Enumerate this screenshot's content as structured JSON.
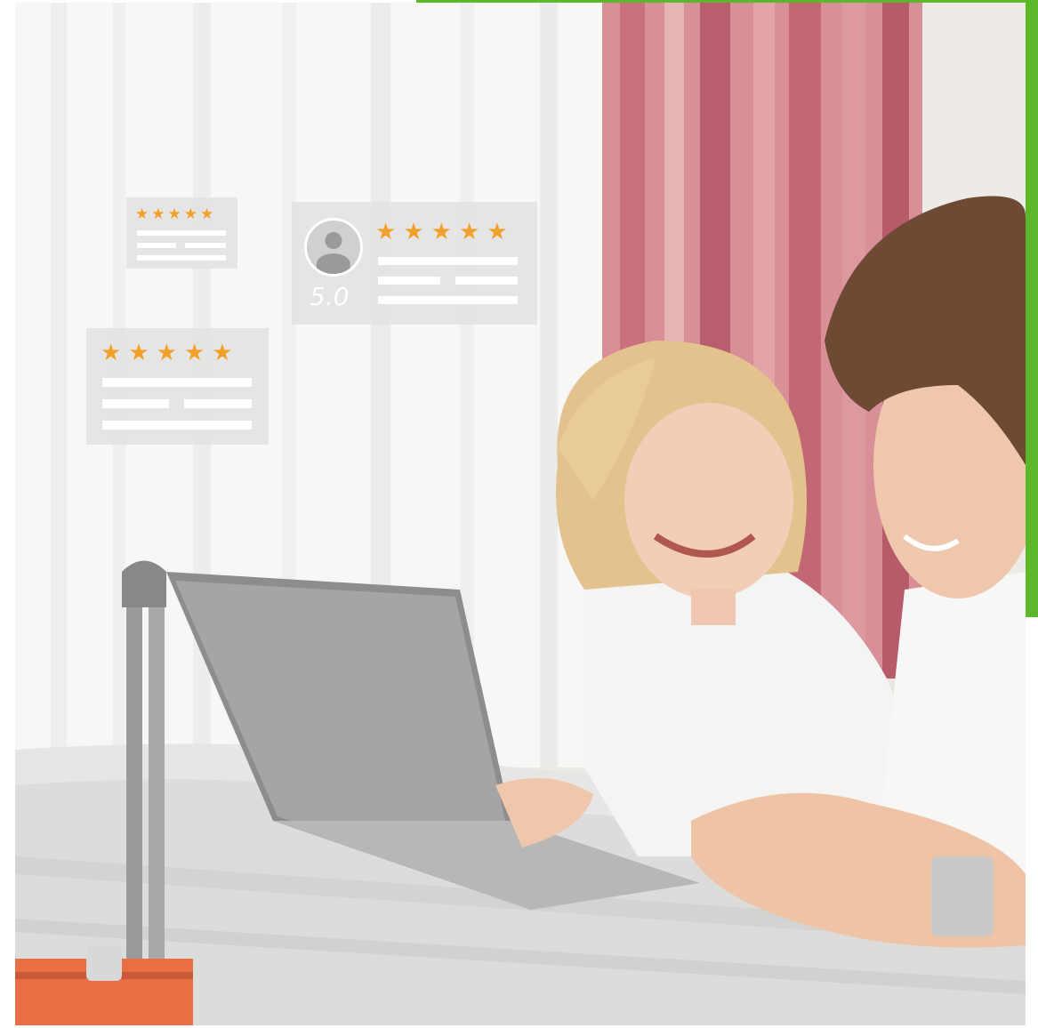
{
  "colors": {
    "accent_green": "#5cb82a",
    "star": "#f2a029",
    "card_bg": "#e2e2e2",
    "curtain_pink": "#c8707e"
  },
  "review_cards": [
    {
      "name": "small-card",
      "stars": 5
    },
    {
      "name": "profile-card",
      "stars": 5,
      "rating": "5.0",
      "icon": "user-avatar-icon"
    },
    {
      "name": "medium-card",
      "stars": 5
    }
  ],
  "scene": {
    "subjects": [
      "woman",
      "man",
      "laptop",
      "suitcase",
      "bed",
      "curtain"
    ]
  }
}
